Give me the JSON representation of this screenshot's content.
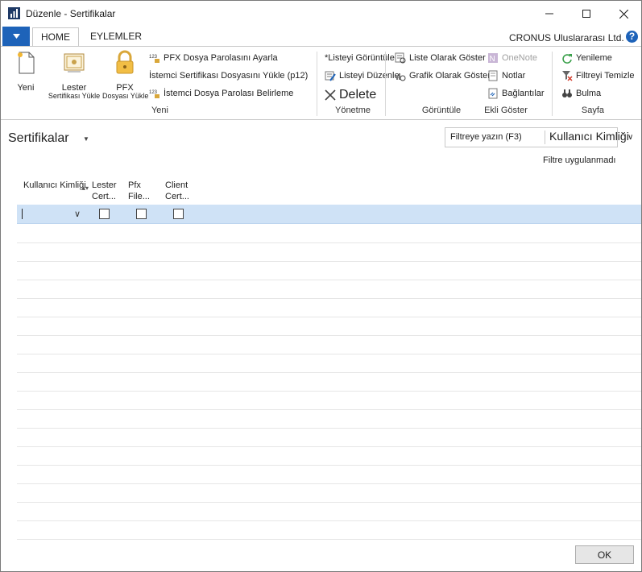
{
  "window": {
    "title": "Düzenle - Sertifikalar"
  },
  "tabs": {
    "home": "HOME",
    "actions": "EYLEMLER"
  },
  "company": "CRONUS Uluslararası Ltd.",
  "help_label": "?",
  "ribbon": {
    "new_btn": "Yeni",
    "upload_lester": {
      "label": "Lester",
      "sub": "Sertifikası Yükle"
    },
    "upload_pfx": {
      "label": "PFX",
      "sub": "Dosyası Yükle"
    },
    "set_pfx_password": "PFX Dosya Parolasını Ayarla",
    "upload_client_cert": "İstemci Sertifikası Dosyasını Yükle (p12)",
    "set_client_password": "İstemci Dosya Parolası Belirleme",
    "group_new": "Yeni",
    "view_list": "*Listeyi Görüntüle",
    "edit_list": "Listeyi Düzenle",
    "delete": "Delete",
    "group_manage": "Yönetme",
    "show_as_list": "Liste Olarak Göster",
    "show_as_chart": "Grafik Olarak Göster",
    "group_view": "Görüntüle",
    "onenote": "OneNote",
    "notes": "Notlar",
    "links": "Bağlantılar",
    "group_attached": "Ekli Göster",
    "refresh": "Yenileme",
    "clear_filter": "Filtreyi Temizle",
    "find": "Bulma",
    "group_page": "Sayfa"
  },
  "page": {
    "title": "Sertifikalar",
    "filter_placeholder": "Filtreye yazın (F3)",
    "filter_field": "Kullanıcı Kimliği",
    "filter_status": "Filtre uygulanmadı"
  },
  "columns": [
    {
      "line1": "Kullanıcı Kimliği",
      "line2": ""
    },
    {
      "line1": "Lester",
      "line2": "Cert..."
    },
    {
      "line1": "Pfx",
      "line2": "File..."
    },
    {
      "line1": "Client",
      "line2": "Cert..."
    }
  ],
  "rows": [
    {
      "user_id": "",
      "lester_cert": false,
      "pfx_file": false,
      "client_cert": false
    }
  ],
  "ok_button": "OK",
  "colors": {
    "accent": "#1e63b9",
    "selected_row": "#cfe2f6"
  }
}
